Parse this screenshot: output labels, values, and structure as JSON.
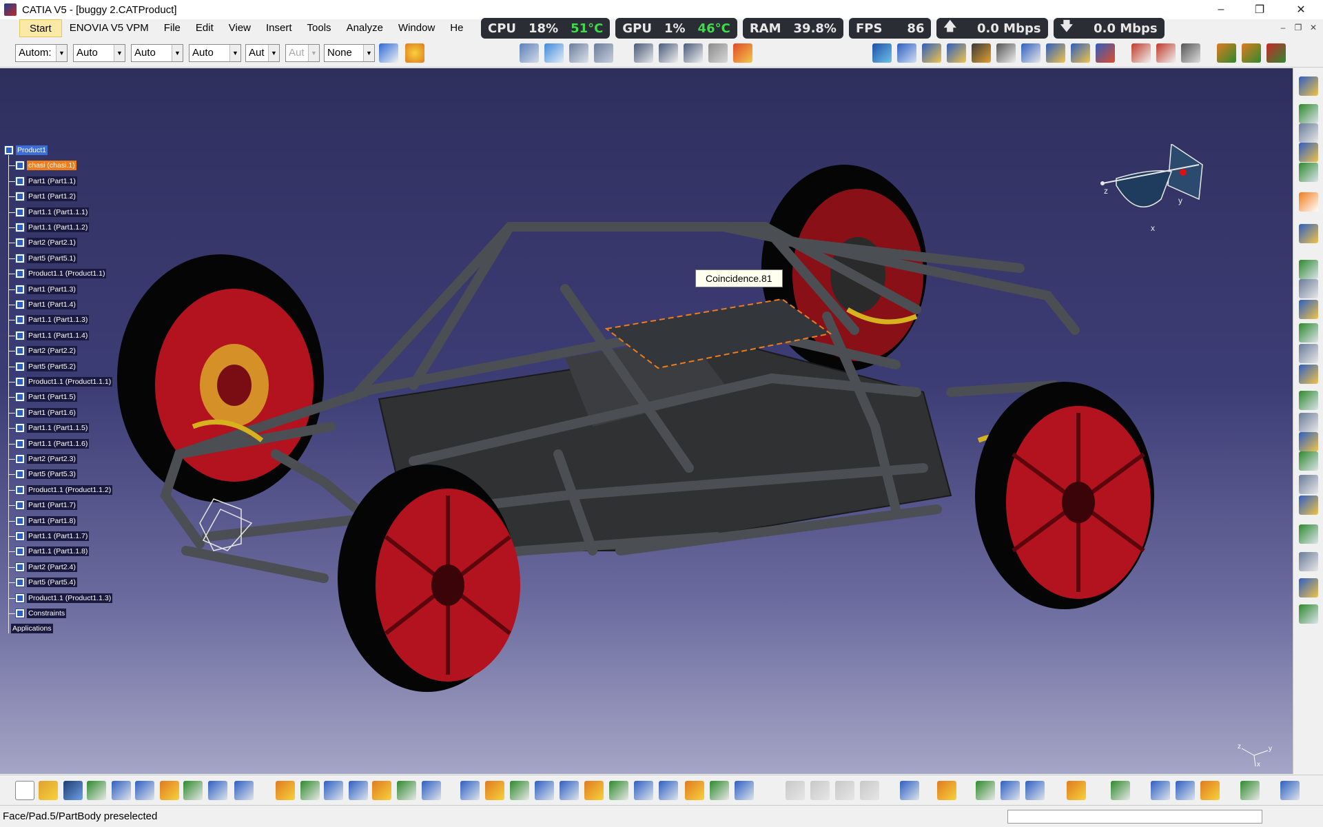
{
  "window": {
    "title": "CATIA V5 - [buggy 2.CATProduct]",
    "controls": [
      "–",
      "❐",
      "✕"
    ]
  },
  "menu": {
    "items": [
      "Start",
      "ENOVIA V5 VPM",
      "File",
      "Edit",
      "View",
      "Insert",
      "Tools",
      "Analyze",
      "Window",
      "He"
    ]
  },
  "performance": {
    "cpu_label": "CPU",
    "cpu_value": "18%",
    "cpu_temp": "51°C",
    "gpu_label": "GPU",
    "gpu_value": "1%",
    "gpu_temp": "46°C",
    "ram_label": "RAM",
    "ram_value": "39.8%",
    "fps_label": "FPS",
    "fps_value": "86",
    "up_value": "0.0 Mbps",
    "down_value": "0.0 Mbps"
  },
  "graphic_properties": {
    "combos": [
      "Autom:",
      "Auto",
      "Auto",
      "Auto",
      "Aut",
      "Aut",
      "None"
    ]
  },
  "tree": {
    "root": "Product1",
    "items": [
      "chasi (chasi.1)",
      "Part1 (Part1.1)",
      "Part1 (Part1.2)",
      "Part1.1 (Part1.1.1)",
      "Part1.1 (Part1.1.2)",
      "Part2 (Part2.1)",
      "Part5 (Part5.1)",
      "Product1.1 (Product1.1)",
      "Part1 (Part1.3)",
      "Part1 (Part1.4)",
      "Part1.1 (Part1.1.3)",
      "Part1.1 (Part1.1.4)",
      "Part2 (Part2.2)",
      "Part5 (Part5.2)",
      "Product1.1 (Product1.1.1)",
      "Part1 (Part1.5)",
      "Part1 (Part1.6)",
      "Part1.1 (Part1.1.5)",
      "Part1.1 (Part1.1.6)",
      "Part2 (Part2.3)",
      "Part5 (Part5.3)",
      "Product1.1 (Product1.1.2)",
      "Part1 (Part1.7)",
      "Part1 (Part1.8)",
      "Part1.1 (Part1.1.7)",
      "Part1.1 (Part1.1.8)",
      "Part2 (Part2.4)",
      "Part5 (Part5.4)",
      "Product1.1 (Product1.1.3)",
      "Constraints"
    ],
    "applications": "Applications"
  },
  "viewport": {
    "tooltip": "Coincidence.81",
    "compass_axes": [
      "z",
      "y",
      "x"
    ]
  },
  "status": {
    "message": "Face/Pad.5/PartBody preselected"
  },
  "colors": {
    "accent_selection": "#f07c1a",
    "background_top": "#2f2f5e",
    "background_bottom": "#a5a5c6",
    "rim_red": "#b3121f"
  }
}
